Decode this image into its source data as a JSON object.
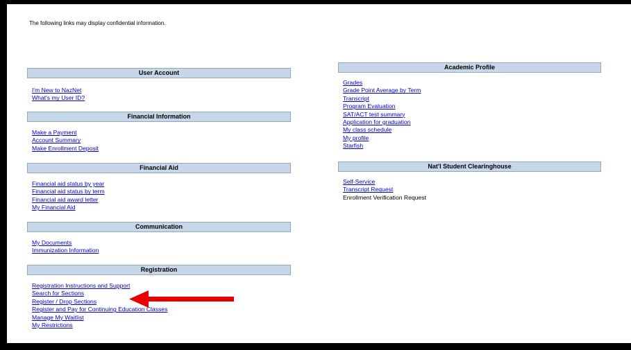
{
  "notice": "The following links may display confidential information.",
  "sections": {
    "user_account": {
      "title": "User Account",
      "links": [
        "I'm New to NazNet",
        "What's my User ID?"
      ]
    },
    "financial_information": {
      "title": "Financial Information",
      "links": [
        "Make a Payment",
        "Account Summary",
        "Make Enrollment Deposit"
      ]
    },
    "financial_aid": {
      "title": "Financial Aid",
      "links": [
        "Financial aid status by year",
        "Financial aid status by term",
        "Financial aid award letter",
        "My Financial Aid"
      ]
    },
    "communication": {
      "title": "Communication",
      "links": [
        "My Documents",
        "Immunization Information"
      ]
    },
    "registration": {
      "title": "Registration",
      "links": [
        "Registration Instructions and Support",
        "Search for Sections",
        "Register / Drop Sections",
        "Register and Pay for Continuing Education Classes",
        "Manage My Waitlist",
        "My Restrictions"
      ]
    },
    "academic_profile": {
      "title": "Academic Profile",
      "links": [
        "Grades",
        "Grade Point Average by Term",
        "Transcript",
        "Program Evaluation",
        "SAT/ACT test summary",
        "Application for graduation",
        "My class schedule",
        "My profile",
        "Starfish"
      ]
    },
    "clearinghouse": {
      "title": "Nat'l Student Clearinghouse",
      "links": [
        "Self-Service",
        "Transcript Request",
        "Enrollment Verification Request"
      ]
    }
  },
  "colors": {
    "header_bg": "#c6d7e9",
    "link": "#0000cc",
    "arrow": "#e60000"
  }
}
